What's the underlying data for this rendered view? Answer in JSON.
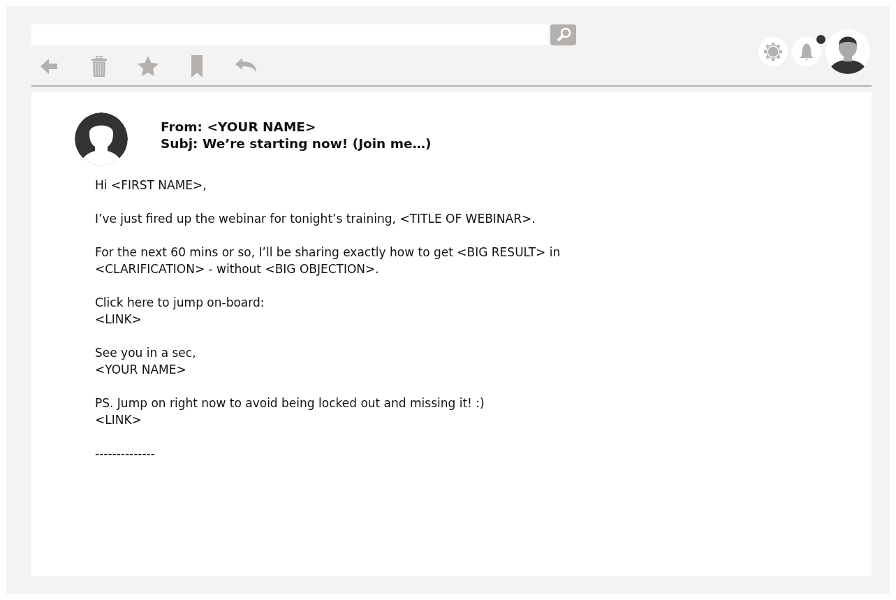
{
  "toolbar": [
    {
      "kind": "back"
    },
    {
      "kind": "trash"
    },
    {
      "kind": "star"
    },
    {
      "kind": "bookmark"
    },
    {
      "kind": "reply"
    }
  ],
  "header_icons": {
    "notification_unread": true
  },
  "email": {
    "from": "From: <YOUR NAME>",
    "subject": "Subj: We’re starting now! (Join me…)",
    "paragraphs": [
      {
        "lines": [
          "Hi <FIRST NAME>,"
        ]
      },
      {
        "lines": [
          "I’ve just fired up the webinar for tonight’s training, <TITLE OF WEBINAR>."
        ]
      },
      {
        "lines": [
          "For the next 60 mins or so, I’ll be sharing exactly how to get <BIG RESULT> in",
          "<CLARIFICATION> - without <BIG OBJECTION>."
        ]
      },
      {
        "lines": [
          "Click here to jump on-board:",
          "<LINK>"
        ]
      },
      {
        "lines": [
          "See you in a sec,",
          "<YOUR NAME>"
        ]
      },
      {
        "lines": [
          "PS. Jump on right now to avoid being locked out and missing it! :)",
          "<LINK>"
        ]
      },
      {
        "lines": [
          "--------------"
        ]
      }
    ]
  }
}
